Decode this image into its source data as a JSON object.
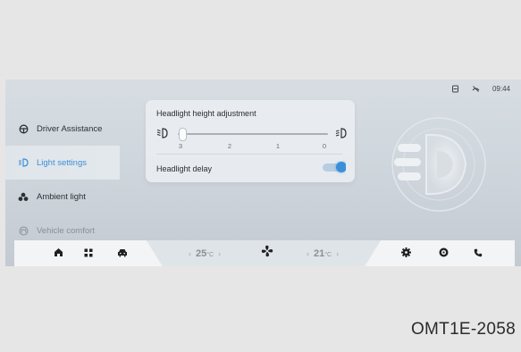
{
  "status_bar": {
    "time": "09:44",
    "icons": [
      "sd-card-icon",
      "no-signal-icon"
    ]
  },
  "sidebar": {
    "items": [
      {
        "label": "Driver Assistance",
        "icon": "steering-wheel-icon",
        "active": false
      },
      {
        "label": "Light settings",
        "icon": "headlight-icon",
        "active": true
      },
      {
        "label": "Ambient light",
        "icon": "ambient-light-icon",
        "active": false
      },
      {
        "label": "Vehicle comfort",
        "icon": "seat-icon",
        "active": false
      }
    ]
  },
  "headlight_panel": {
    "title": "Headlight height adjustment",
    "ticks": [
      "3",
      "2",
      "1",
      "0"
    ],
    "selected_level": "3",
    "delay_label": "Headlight delay",
    "delay_enabled": true
  },
  "dock": {
    "left_temp": {
      "value": "25",
      "unit": "°C",
      "dec": "‹",
      "inc": "›"
    },
    "right_temp": {
      "value": "21",
      "unit": "°C",
      "dec": "‹",
      "inc": "›"
    },
    "left_buttons": [
      "home-icon",
      "apps-grid-icon",
      "car-icon"
    ],
    "center_button": "fan-icon",
    "right_buttons": [
      "settings-icon",
      "media-icon",
      "phone-icon"
    ]
  },
  "colors": {
    "accent": "#3a8fd9",
    "screen_bg": "#cfd6dd",
    "dock_bg": "#f3f5f7"
  },
  "caption": "OMT1E-2058"
}
